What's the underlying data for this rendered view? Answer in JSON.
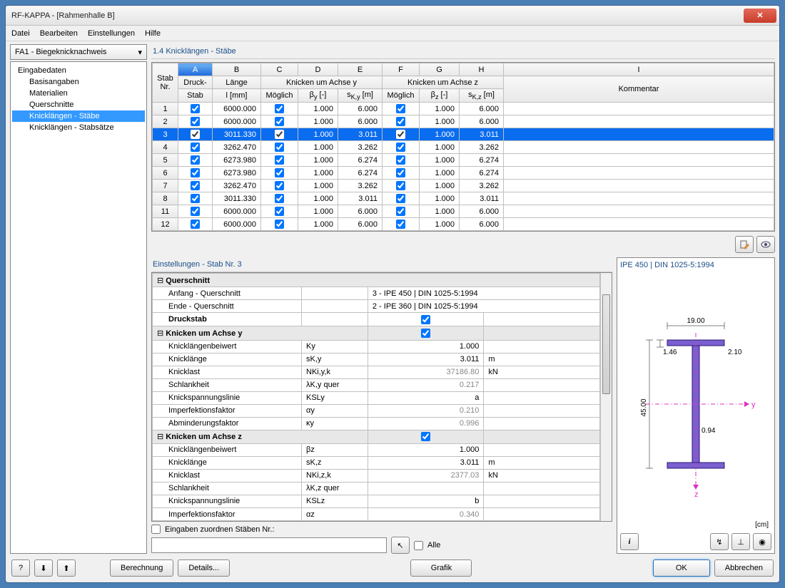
{
  "title": "RF-KAPPA - [Rahmenhalle B]",
  "menu": [
    "Datei",
    "Bearbeiten",
    "Einstellungen",
    "Hilfe"
  ],
  "dropdown": "FA1 - Biegeknicknachweis",
  "tree": {
    "root": "Eingabedaten",
    "items": [
      "Basisangaben",
      "Materialien",
      "Querschnitte",
      "Knicklängen - Stäbe",
      "Knicklängen - Stabsätze"
    ],
    "selectedIndex": 3
  },
  "sectionTitle": "1.4 Knicklängen - Stäbe",
  "cols": {
    "letters": [
      "A",
      "B",
      "C",
      "D",
      "E",
      "F",
      "G",
      "H",
      "I"
    ],
    "group1": "Knicken um Achse y",
    "group2": "Knicken um Achse z",
    "stab": "Stab",
    "nr": "Nr.",
    "druck": "Druck-",
    "stab2": "Stab",
    "laenge": "Länge",
    "lmm": "l [mm]",
    "moeg": "Möglich",
    "by": "βy [-]",
    "sky": "sK,y [m]",
    "bz": "βz [-]",
    "skz": "sK,z [m]",
    "komm": "Kommentar"
  },
  "rows": [
    {
      "nr": "1",
      "l": "6000.000",
      "by": "1.000",
      "sy": "6.000",
      "bz": "1.000",
      "sz": "6.000"
    },
    {
      "nr": "2",
      "l": "6000.000",
      "by": "1.000",
      "sy": "6.000",
      "bz": "1.000",
      "sz": "6.000"
    },
    {
      "nr": "3",
      "l": "3011.330",
      "by": "1.000",
      "sy": "3.011",
      "bz": "1.000",
      "sz": "3.011",
      "sel": true
    },
    {
      "nr": "4",
      "l": "3262.470",
      "by": "1.000",
      "sy": "3.262",
      "bz": "1.000",
      "sz": "3.262"
    },
    {
      "nr": "5",
      "l": "6273.980",
      "by": "1.000",
      "sy": "6.274",
      "bz": "1.000",
      "sz": "6.274"
    },
    {
      "nr": "6",
      "l": "6273.980",
      "by": "1.000",
      "sy": "6.274",
      "bz": "1.000",
      "sz": "6.274"
    },
    {
      "nr": "7",
      "l": "3262.470",
      "by": "1.000",
      "sy": "3.262",
      "bz": "1.000",
      "sz": "3.262"
    },
    {
      "nr": "8",
      "l": "3011.330",
      "by": "1.000",
      "sy": "3.011",
      "bz": "1.000",
      "sz": "3.011"
    },
    {
      "nr": "11",
      "l": "6000.000",
      "by": "1.000",
      "sy": "6.000",
      "bz": "1.000",
      "sz": "6.000"
    },
    {
      "nr": "12",
      "l": "6000.000",
      "by": "1.000",
      "sy": "6.000",
      "bz": "1.000",
      "sz": "6.000"
    }
  ],
  "settingsTitle": "Einstellungen  -  Stab Nr.  3",
  "settings": {
    "grp1": "Querschnitt",
    "anfQ": {
      "lbl": "Anfang - Querschnitt",
      "val": "3 - IPE 450 | DIN 1025-5:1994"
    },
    "endQ": {
      "lbl": "Ende - Querschnitt",
      "val": "2 - IPE 360 | DIN 1025-5:1994"
    },
    "druck": {
      "lbl": "Druckstab"
    },
    "grp2": "Knicken um Achse y",
    "kyb": {
      "lbl": "Knicklängenbeiwert",
      "sym": "Ky",
      "val": "1.000"
    },
    "kyl": {
      "lbl": "Knicklänge",
      "sym": "sK,y",
      "val": "3.011",
      "unit": "m"
    },
    "kyn": {
      "lbl": "Knicklast",
      "sym": "NKi,y,k",
      "val": "37186.80",
      "unit": "kN",
      "gray": true
    },
    "kys": {
      "lbl": "Schlankheit",
      "sym": "λK,y quer",
      "val": "0.217",
      "gray": true
    },
    "kyk": {
      "lbl": "Knickspannungslinie",
      "sym": "KSLy",
      "val": "a"
    },
    "kyi": {
      "lbl": "Imperfektionsfaktor",
      "sym": "αy",
      "val": "0.210",
      "gray": true
    },
    "kya": {
      "lbl": "Abminderungsfaktor",
      "sym": "κy",
      "val": "0.996",
      "gray": true
    },
    "grp3": "Knicken um Achse z",
    "kzb": {
      "lbl": "Knicklängenbeiwert",
      "sym": "βz",
      "val": "1.000"
    },
    "kzl": {
      "lbl": "Knicklänge",
      "sym": "sK,z",
      "val": "3.011",
      "unit": "m"
    },
    "kzn": {
      "lbl": "Knicklast",
      "sym": "NKi,z,k",
      "val": "2377.03",
      "unit": "kN",
      "gray": true
    },
    "kzs": {
      "lbl": "Schlankheit",
      "sym": "λK,z quer",
      "val": "",
      "gray": true
    },
    "kzk": {
      "lbl": "Knickspannungslinie",
      "sym": "KSLz",
      "val": "b"
    },
    "kzi": {
      "lbl": "Imperfektionsfaktor",
      "sym": "αz",
      "val": "0.340",
      "gray": true
    }
  },
  "assign": {
    "lbl": "Eingaben zuordnen Stäben Nr.:",
    "alle": "Alle"
  },
  "preview": {
    "title": "IPE 450 | DIN 1025-5:1994",
    "unit": "[cm]",
    "dims": {
      "w": "19.00",
      "h": "45.00",
      "tf": "1.46",
      "r": "2.10",
      "tw": "0.94"
    }
  },
  "buttons": {
    "calc": "Berechnung",
    "details": "Details...",
    "grafik": "Grafik",
    "ok": "OK",
    "cancel": "Abbrechen"
  }
}
